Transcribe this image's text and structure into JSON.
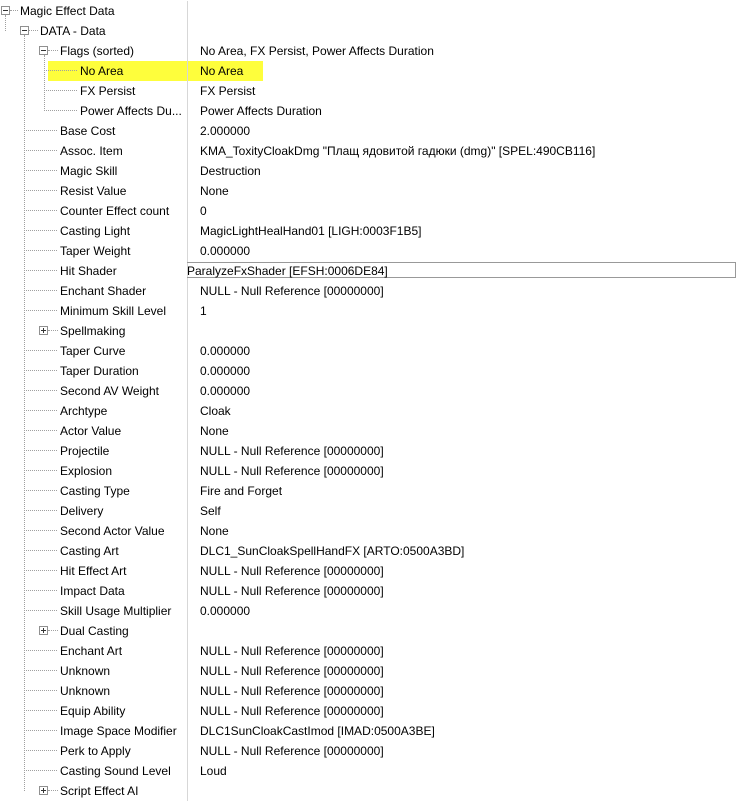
{
  "tree": {
    "rows": [
      {
        "label": "Magic Effect Data",
        "value": "",
        "level": 0,
        "expander": "minus"
      },
      {
        "label": "DATA - Data",
        "value": "",
        "level": 1,
        "expander": "minus"
      },
      {
        "label": "Flags (sorted)",
        "value": "No Area, FX Persist, Power Affects Duration",
        "level": 2,
        "expander": "minus"
      },
      {
        "label": "No Area",
        "value": "No Area",
        "level": 3,
        "highlighted": true
      },
      {
        "label": "FX Persist",
        "value": "FX Persist",
        "level": 3
      },
      {
        "label": "Power Affects Du...",
        "value": "Power Affects Duration",
        "level": 3
      },
      {
        "label": "Base Cost",
        "value": "2.000000",
        "level": 2
      },
      {
        "label": "Assoc. Item",
        "value": "KMA_ToxityCloakDmg \"Плащ ядовитой гадюки (dmg)\" [SPEL:490CB116]",
        "level": 2
      },
      {
        "label": "Magic Skill",
        "value": "Destruction",
        "level": 2
      },
      {
        "label": "Resist Value",
        "value": "None",
        "level": 2
      },
      {
        "label": "Counter Effect count",
        "value": "0",
        "level": 2
      },
      {
        "label": "Casting Light",
        "value": "MagicLightHealHand01 [LIGH:0003F1B5]",
        "level": 2
      },
      {
        "label": "Taper Weight",
        "value": "0.000000",
        "level": 2
      },
      {
        "label": "Hit Shader",
        "value": "ParalyzeFxShader [EFSH:0006DE84]",
        "level": 2,
        "editing": true
      },
      {
        "label": "Enchant Shader",
        "value": "NULL - Null Reference [00000000]",
        "level": 2
      },
      {
        "label": "Minimum Skill Level",
        "value": "1",
        "level": 2
      },
      {
        "label": "Spellmaking",
        "value": "",
        "level": 2,
        "expander": "plus"
      },
      {
        "label": "Taper Curve",
        "value": "0.000000",
        "level": 2
      },
      {
        "label": "Taper Duration",
        "value": "0.000000",
        "level": 2
      },
      {
        "label": "Second AV Weight",
        "value": "0.000000",
        "level": 2
      },
      {
        "label": "Archtype",
        "value": "Cloak",
        "level": 2
      },
      {
        "label": "Actor Value",
        "value": "None",
        "level": 2
      },
      {
        "label": "Projectile",
        "value": "NULL - Null Reference [00000000]",
        "level": 2
      },
      {
        "label": "Explosion",
        "value": "NULL - Null Reference [00000000]",
        "level": 2
      },
      {
        "label": "Casting Type",
        "value": "Fire and Forget",
        "level": 2
      },
      {
        "label": "Delivery",
        "value": "Self",
        "level": 2
      },
      {
        "label": "Second Actor Value",
        "value": "None",
        "level": 2
      },
      {
        "label": "Casting Art",
        "value": "DLC1_SunCloakSpellHandFX [ARTO:0500A3BD]",
        "level": 2
      },
      {
        "label": "Hit Effect Art",
        "value": "NULL - Null Reference [00000000]",
        "level": 2
      },
      {
        "label": "Impact Data",
        "value": "NULL - Null Reference [00000000]",
        "level": 2
      },
      {
        "label": "Skill Usage Multiplier",
        "value": "0.000000",
        "level": 2
      },
      {
        "label": "Dual Casting",
        "value": "",
        "level": 2,
        "expander": "plus"
      },
      {
        "label": "Enchant Art",
        "value": "NULL - Null Reference [00000000]",
        "level": 2
      },
      {
        "label": "Unknown",
        "value": "NULL - Null Reference [00000000]",
        "level": 2
      },
      {
        "label": "Unknown",
        "value": "NULL - Null Reference [00000000]",
        "level": 2
      },
      {
        "label": "Equip Ability",
        "value": "NULL - Null Reference [00000000]",
        "level": 2
      },
      {
        "label": "Image Space Modifier",
        "value": "DLC1SunCloakCastImod [IMAD:0500A3BE]",
        "level": 2
      },
      {
        "label": "Perk to Apply",
        "value": "NULL - Null Reference [00000000]",
        "level": 2
      },
      {
        "label": "Casting Sound Level",
        "value": "Loud",
        "level": 2
      },
      {
        "label": "Script Effect AI",
        "value": "",
        "level": 2,
        "expander": "plus"
      }
    ]
  },
  "colors": {
    "highlight": "#fefe3c",
    "tree_line": "#a0a0a0",
    "column_separator": "#d7d7d7"
  }
}
